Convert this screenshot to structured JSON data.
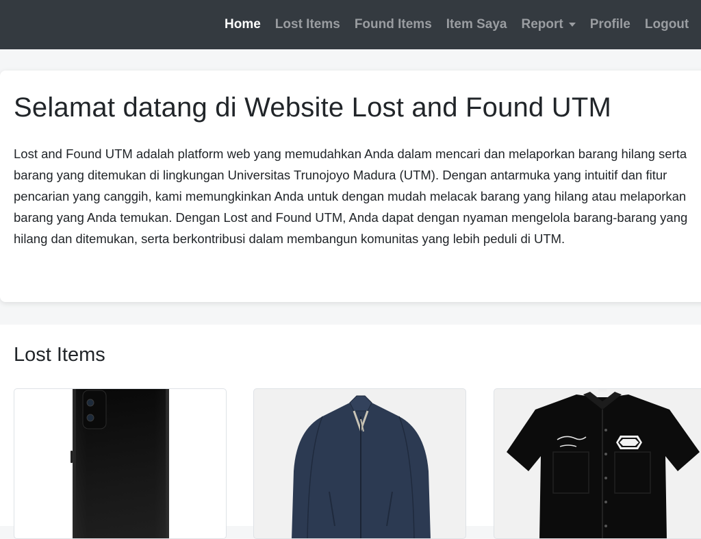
{
  "navbar": {
    "links": [
      {
        "label": "Home",
        "active": true
      },
      {
        "label": "Lost Items"
      },
      {
        "label": "Found Items"
      },
      {
        "label": "Item Saya"
      },
      {
        "label": "Report",
        "dropdown": true
      },
      {
        "label": "Profile"
      },
      {
        "label": "Logout"
      }
    ]
  },
  "hero": {
    "title": "Selamat datang di Website Lost and Found UTM",
    "description": "Lost and Found UTM adalah platform web yang memudahkan Anda dalam mencari dan melaporkan barang hilang serta barang yang ditemukan di lingkungan Universitas Trunojoyo Madura (UTM). Dengan antarmuka yang intuitif dan fitur pencarian yang canggih, kami memungkinkan Anda untuk dengan mudah melacak barang yang hilang atau melaporkan barang yang Anda temukan. Dengan Lost and Found UTM, Anda dapat dengan nyaman mengelola barang-barang yang hilang dan ditemukan, serta berkontribusi dalam membangun komunitas yang lebih peduli di UTM."
  },
  "lost_items": {
    "title": "Lost Items",
    "cards": [
      {
        "image": "black-smartphone"
      },
      {
        "image": "navy-jacket"
      },
      {
        "image": "black-shirt"
      }
    ]
  },
  "colors": {
    "navbar_bg": "#343a40",
    "nav_active": "#ffffff",
    "nav_muted": "#9a9da1",
    "page_bg": "#f5f6f7"
  }
}
